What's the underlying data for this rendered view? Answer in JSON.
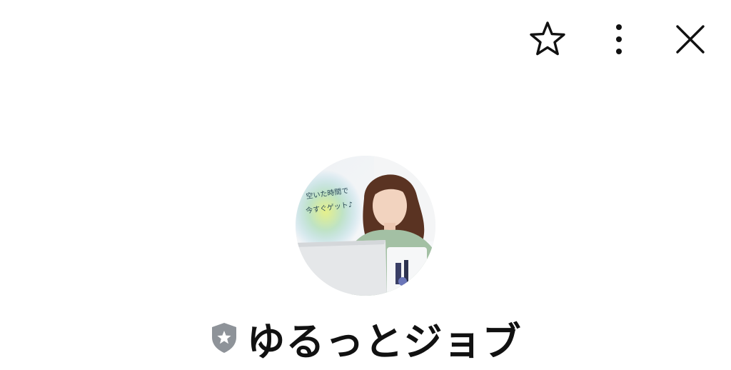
{
  "profile": {
    "name": "ゆるっとジョブ",
    "avatar": {
      "caption_line1": "空いた時間で",
      "caption_line2": "今すぐゲット♪"
    },
    "badge_icon": "shield-star-icon",
    "badge_color": "#8e9399"
  },
  "toolbar": {
    "icons": [
      "star-icon",
      "more-vertical-icon",
      "close-icon"
    ]
  }
}
